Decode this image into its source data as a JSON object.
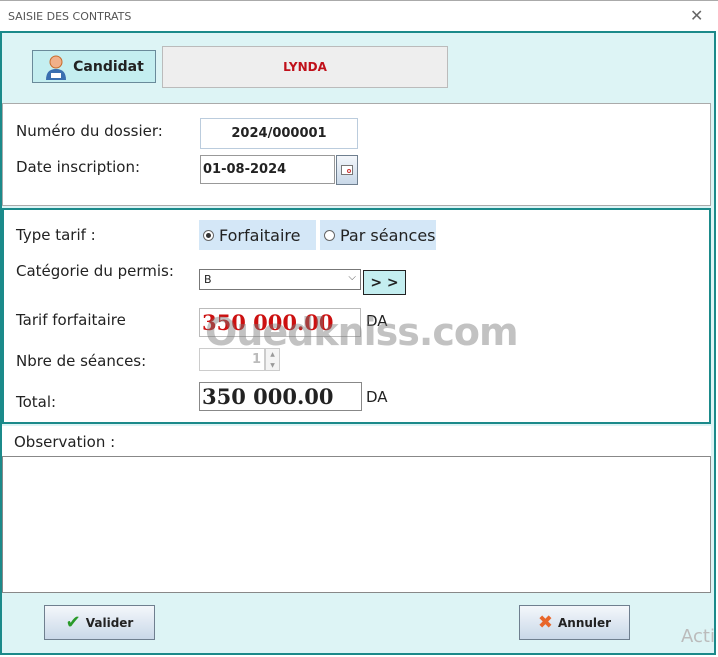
{
  "window": {
    "title": "SAISIE DES CONTRATS",
    "close": "✕"
  },
  "candidat": {
    "button_label": "Candidat",
    "name": "LYNDA"
  },
  "dossier": {
    "numero_label": "Numéro du dossier:",
    "numero_value": "2024/000001",
    "date_label": "Date inscription:",
    "date_value": "01-08-2024"
  },
  "tarif": {
    "type_label": "Type tarif :",
    "options": [
      {
        "label": "Forfaitaire",
        "selected": true
      },
      {
        "label": "Par séances",
        "selected": false
      }
    ],
    "categorie_label": "Catégorie du permis:",
    "categorie_value": "B",
    "next_button": "> >",
    "forfait_label": "Tarif forfaitaire",
    "forfait_value": "350 000.00",
    "currency": "DA",
    "seances_label": "Nbre de séances:",
    "seances_value": "1",
    "total_label": "Total:",
    "total_value": "350 000.00"
  },
  "observation": {
    "label": "Observation :",
    "value": ""
  },
  "actions": {
    "validate": "Valider",
    "cancel": "Annuler"
  },
  "watermark": {
    "text": "Ouedkniss.com"
  },
  "os_overlay": {
    "text": "Acti"
  },
  "colors": {
    "accent": "#1b8a8a",
    "panel_bg": "#ddf4f5",
    "name_red": "#c0101a"
  }
}
